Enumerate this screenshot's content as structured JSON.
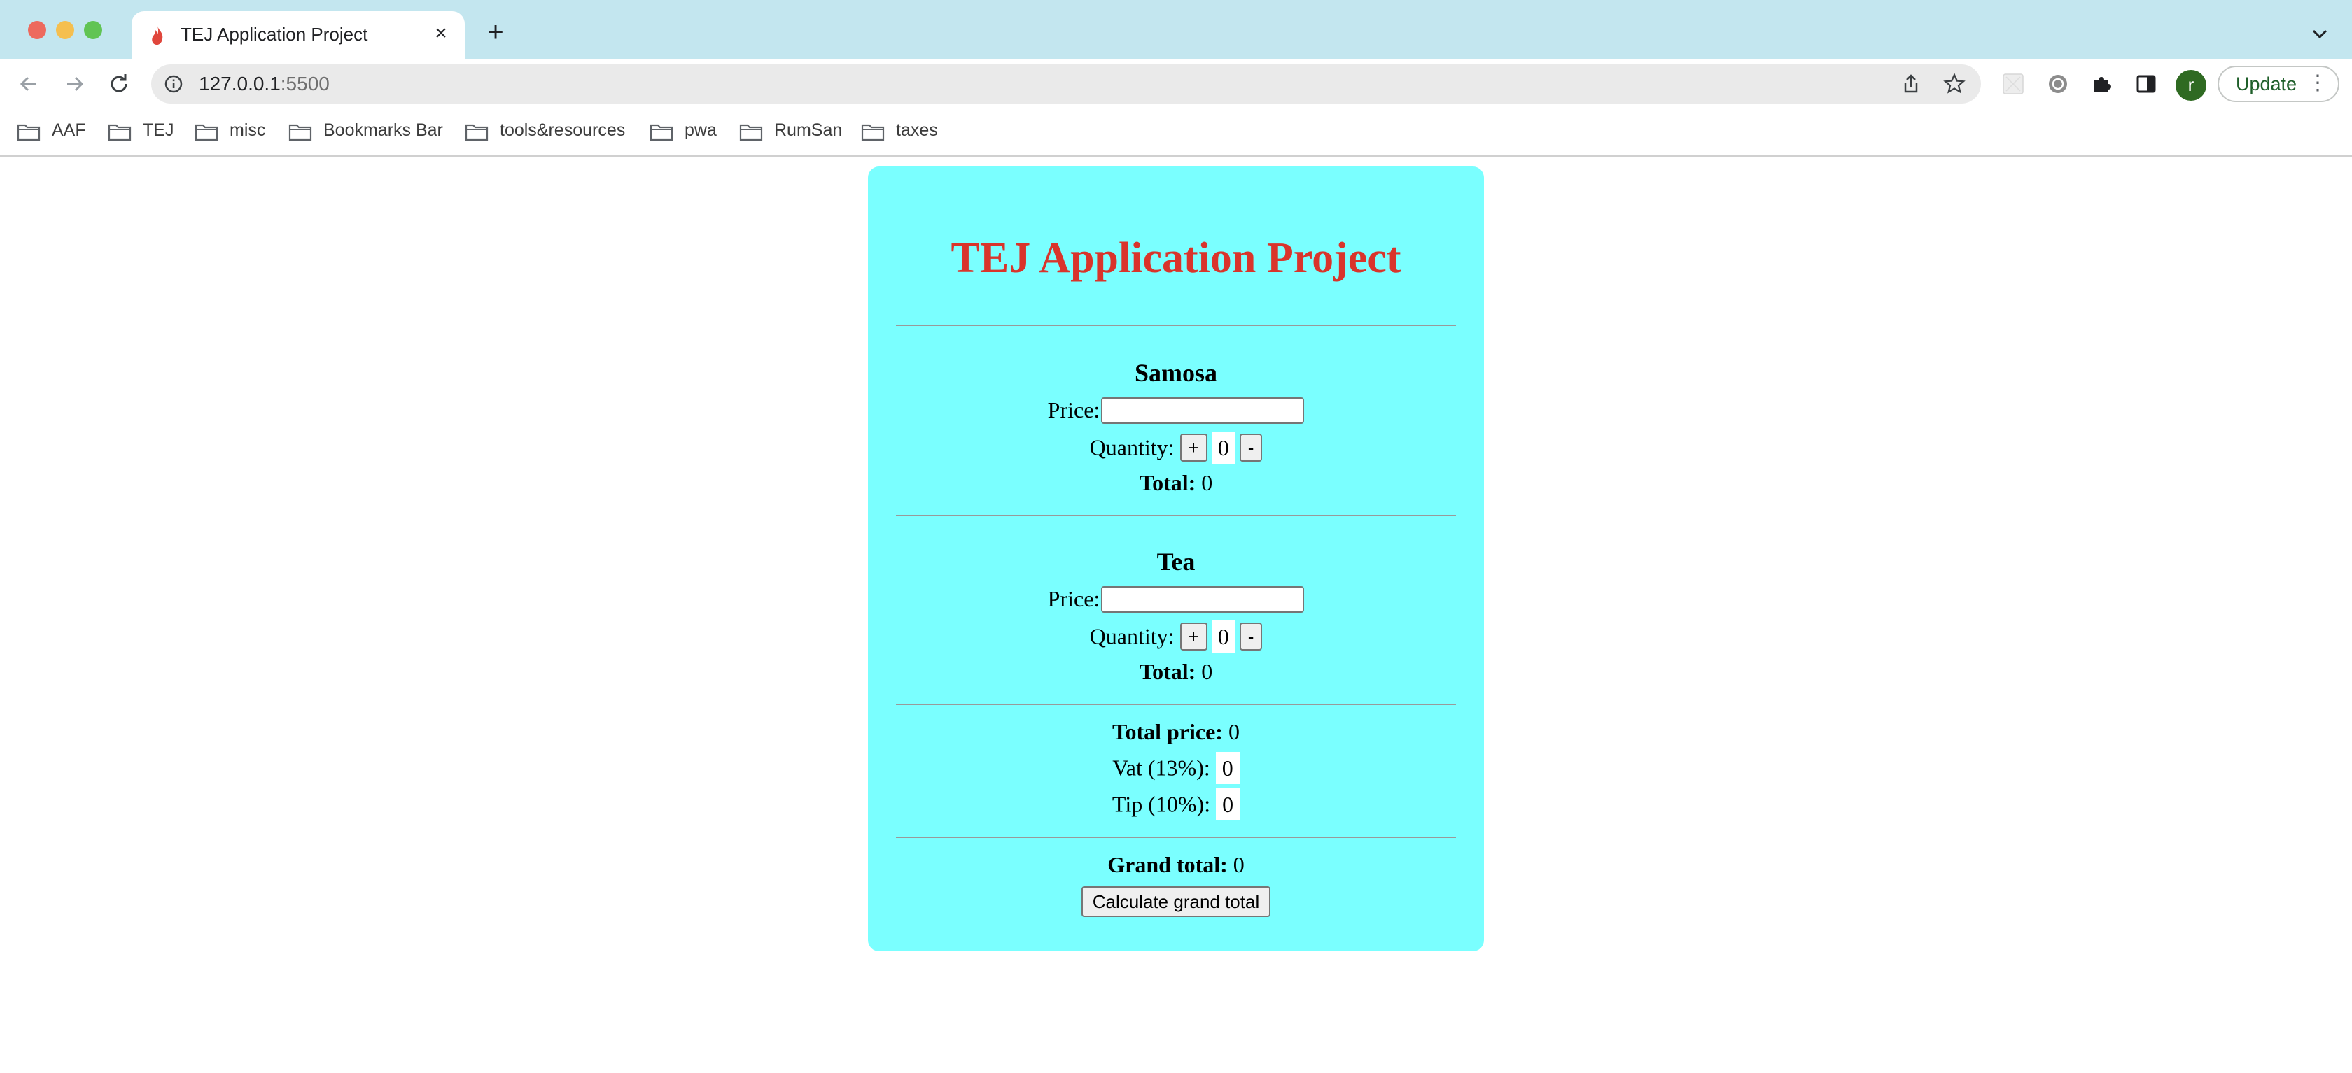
{
  "browser": {
    "tab_title": "TEJ Application Project",
    "url_host": "127.0.0.1",
    "url_port": ":5500",
    "avatar_letter": "r",
    "update_label": "Update",
    "bookmarks": [
      "AAF",
      "TEJ",
      "misc",
      "Bookmarks Bar",
      "tools&resources",
      "pwa",
      "RumSan",
      "taxes"
    ]
  },
  "app": {
    "title": "TEJ Application Project",
    "items": [
      {
        "name": "Samosa",
        "price_label": "Price:",
        "price_value": "",
        "quantity_label": "Quantity:",
        "plus": "+",
        "quantity": "0",
        "minus": "-",
        "total_label": "Total:",
        "total": "0"
      },
      {
        "name": "Tea",
        "price_label": "Price:",
        "price_value": "",
        "quantity_label": "Quantity:",
        "plus": "+",
        "quantity": "0",
        "minus": "-",
        "total_label": "Total:",
        "total": "0"
      }
    ],
    "summary": {
      "total_price_label": "Total price:",
      "total_price": "0",
      "vat_label": "Vat (13%):",
      "vat": "0",
      "tip_label": "Tip (10%):",
      "tip": "0"
    },
    "grand_total_label": "Grand total:",
    "grand_total": "0",
    "calculate_label": "Calculate grand total"
  },
  "colors": {
    "card_background": "#7affff",
    "title": "#d9342b",
    "tabstrip": "#c3e6ef"
  }
}
